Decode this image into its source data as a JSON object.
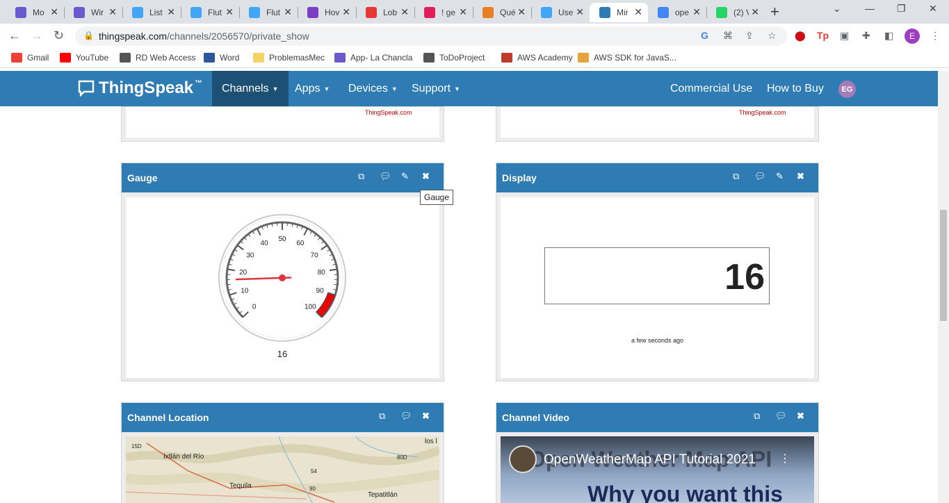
{
  "browser": {
    "tabs": [
      {
        "label": "Mo",
        "color": "#6a5acd"
      },
      {
        "label": "Wir",
        "color": "#6a5acd"
      },
      {
        "label": "List",
        "color": "#42a5f5"
      },
      {
        "label": "Flut",
        "color": "#42a5f5"
      },
      {
        "label": "Flut",
        "color": "#42a5f5"
      },
      {
        "label": "Hov",
        "color": "#7b3fc4"
      },
      {
        "label": "Lob",
        "color": "#e53935"
      },
      {
        "label": "! ge",
        "color": "#e01e5a"
      },
      {
        "label": "Qué",
        "color": "#e67e22"
      },
      {
        "label": "Use",
        "color": "#42a5f5"
      },
      {
        "label": "Mir",
        "color": "#2e7cb3"
      },
      {
        "label": "ope",
        "color": "#4285f4"
      },
      {
        "label": "(2) V",
        "color": "#25d366"
      }
    ],
    "active_tab": 10,
    "url_host": "thingspeak.com",
    "url_path": "/channels/2056570/private_show",
    "profile_letter": "E",
    "bookmarks": [
      {
        "label": "Gmail",
        "color": "#ea4335"
      },
      {
        "label": "YouTube",
        "color": "#ff0000"
      },
      {
        "label": "RD Web Access",
        "color": "#555555"
      },
      {
        "label": "Word",
        "color": "#2b579a"
      },
      {
        "label": "ProblemasMec",
        "color": "#f6d365"
      },
      {
        "label": "App- La Chancla",
        "color": "#6a5acd"
      },
      {
        "label": "ToDoProject",
        "color": "#555555"
      },
      {
        "label": "AWS Academy",
        "color": "#c0392b"
      },
      {
        "label": "AWS SDK for JavaS...",
        "color": "#e6a23c"
      }
    ]
  },
  "site": {
    "logo": "ThingSpeak",
    "logo_tm": "™",
    "nav": {
      "channels": "Channels",
      "apps": "Apps",
      "devices": "Devices",
      "support": "Support",
      "commercial": "Commercial Use",
      "buy": "How to Buy",
      "avatar": "EG"
    },
    "brand_color": "#2e7cb3"
  },
  "panels": {
    "watermark": "ThingSpeak.com",
    "gauge": {
      "title": "Gauge",
      "tooltip": "Gauge",
      "value": 16,
      "value_label": "16",
      "min": 0,
      "max": 100,
      "ticks": [
        "0",
        "10",
        "20",
        "30",
        "40",
        "50",
        "60",
        "70",
        "80",
        "90",
        "100"
      ],
      "danger_from": 90,
      "danger_to": 100
    },
    "display": {
      "title": "Display",
      "value": "16",
      "timestamp": "a few seconds ago"
    },
    "location": {
      "title": "Channel Location",
      "labels": [
        "Ixtlán del Río",
        "Tequila",
        "Tepatitlán",
        "los l",
        "15D",
        "80D",
        "54",
        "90"
      ]
    },
    "video": {
      "title": "Channel Video",
      "video_title": "OpenWeatherMap API Tutorial 2021",
      "overlay_top": "Open Weather Map API",
      "overlay_bottom": "Why you want this"
    }
  }
}
